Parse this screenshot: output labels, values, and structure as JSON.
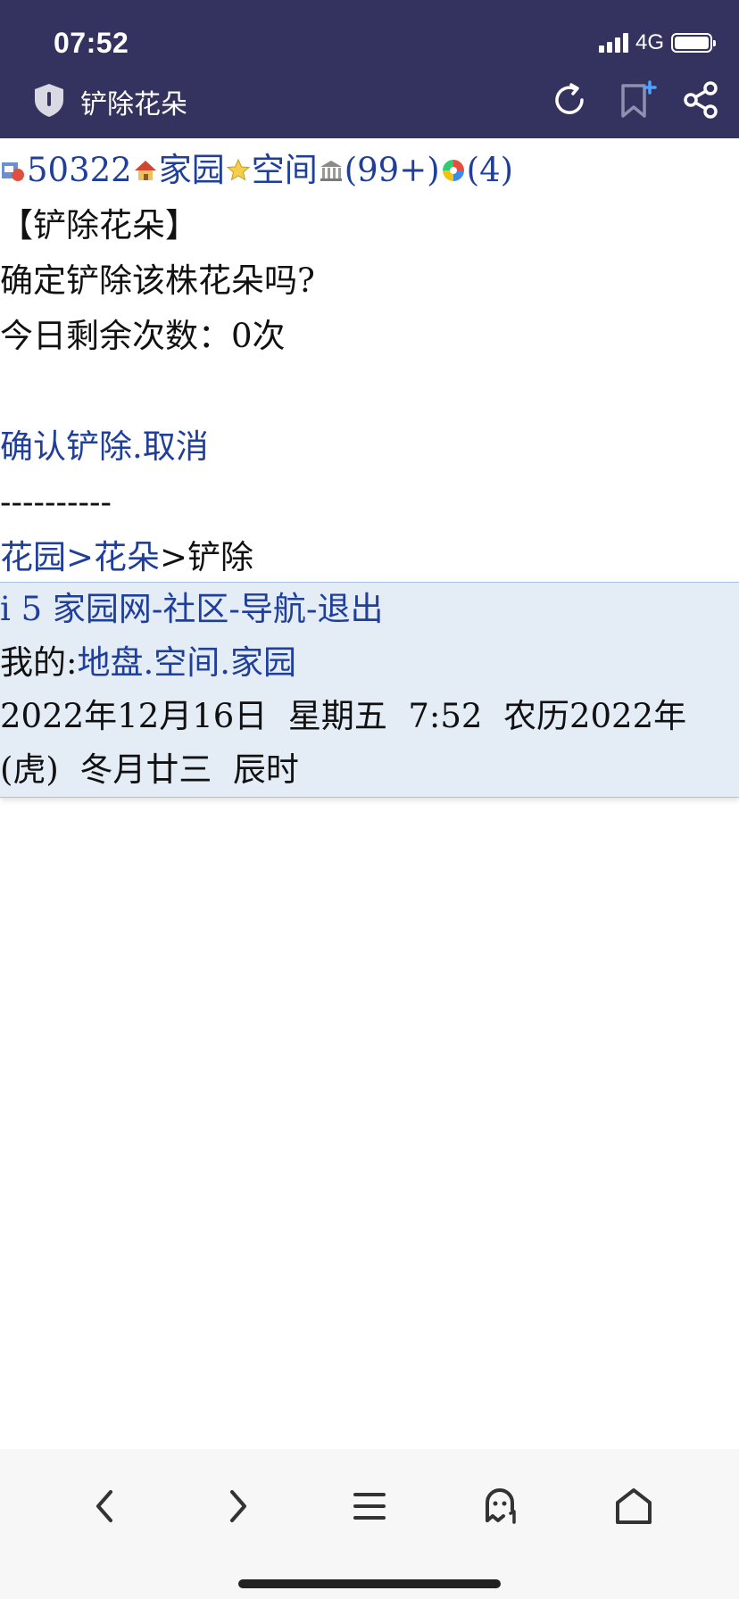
{
  "status": {
    "time": "07:52",
    "network": "4G"
  },
  "header": {
    "title": "铲除花朵"
  },
  "top_links": {
    "count": "50322",
    "home": "家园",
    "space": "空间",
    "msg_count": "(99+)",
    "other_count": "(4)"
  },
  "main": {
    "heading": "【铲除花朵】",
    "question": "确定铲除该株花朵吗?",
    "remaining": "今日剩余次数：0次",
    "confirm": "确认铲除",
    "dot": ".",
    "cancel": "取消",
    "divider": "----------",
    "crumb_garden": "花园",
    "crumb_sep1": ">",
    "crumb_flower": "花朵",
    "crumb_sep2": ">",
    "crumb_current": "铲除"
  },
  "footer": {
    "site": "i 5 家园网",
    "sep1": "-",
    "community": "社区",
    "sep2": "-",
    "nav": "导航",
    "sep3": "-",
    "logout": "退出",
    "mine_label": "我的:",
    "land": "地盘",
    "dot1": ".",
    "space": "空间",
    "dot2": ".",
    "home": "家园",
    "date_line1": "2022年12月16日  星期五  7:52  农历2022年",
    "date_line2": "(虎)  冬月廿三  辰时"
  },
  "colors": {
    "header_bg": "#34325e",
    "link": "#1f3f9a",
    "footer_bg": "#e4ecf6"
  },
  "icons": [
    "shield-icon",
    "refresh-icon",
    "bookmark-add-icon",
    "share-icon",
    "back-icon",
    "forward-icon",
    "menu-icon",
    "ghost-icon",
    "home-icon"
  ]
}
